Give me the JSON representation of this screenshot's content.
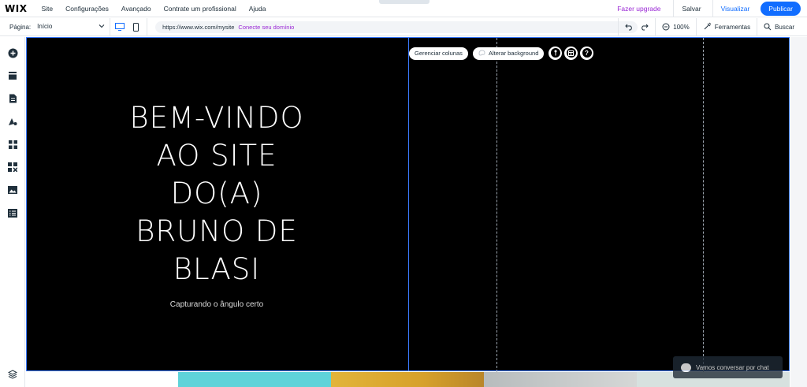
{
  "topbar": {
    "logo": "WIX",
    "menu": [
      "Site",
      "Configurações",
      "Avançado",
      "Contrate um profissional",
      "Ajuda"
    ],
    "upgrade_label": "Fazer upgrade",
    "save_label": "Salvar",
    "preview_label": "Visualizar",
    "publish_label": "Publicar"
  },
  "subbar": {
    "page_label": "Página:",
    "page_value": "Início",
    "url": "https://www.wix.com/mysite",
    "connect_domain": "Conecte seu domínio",
    "zoom": "100%",
    "tools_label": "Ferramentas",
    "search_label": "Buscar"
  },
  "canvas": {
    "headline": [
      "BEM-VINDO",
      "AO SITE",
      "DO(A)",
      "BRUNO DE",
      "BLASI"
    ],
    "subtitle": "Capturando o ângulo certo",
    "manage_columns": "Gerenciar colunas",
    "change_background": "Alterar background"
  },
  "chat": {
    "label": "Vamos conversar por chat"
  },
  "colors": {
    "accent": "#116dff",
    "upgrade": "#9a27d5",
    "selection": "#3b7bff"
  }
}
